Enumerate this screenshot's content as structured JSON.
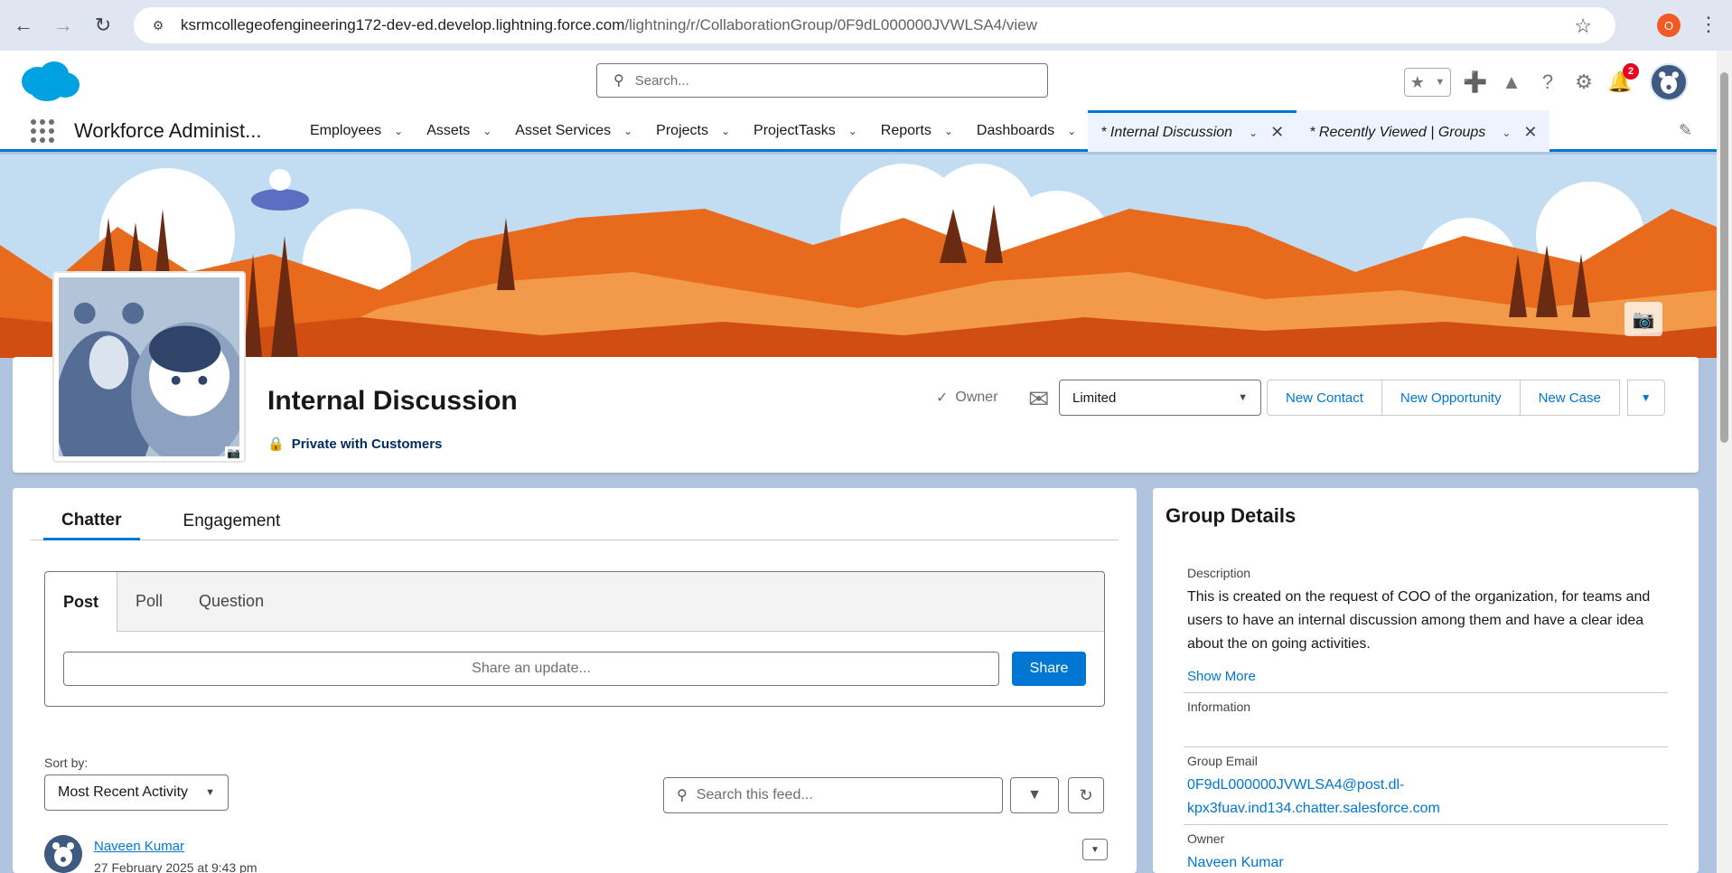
{
  "browser": {
    "url_host": "ksrmcollegeofengineering172-dev-ed.develop.lightning.force.com",
    "url_path": "/lightning/r/CollaborationGroup/0F9dL000000JVWLSA4/view",
    "profile_initial": "O"
  },
  "header": {
    "search_placeholder": "Search...",
    "notification_count": "2"
  },
  "app_nav": {
    "app_name": "Workforce Administ...",
    "items": [
      {
        "label": "Employees"
      },
      {
        "label": "Assets"
      },
      {
        "label": "Asset Services"
      },
      {
        "label": "Projects"
      },
      {
        "label": "ProjectTasks"
      },
      {
        "label": "Reports"
      },
      {
        "label": "Dashboards"
      }
    ],
    "tabs": [
      {
        "label": "* Internal Discussion"
      },
      {
        "label": "* Recently Viewed | Groups"
      }
    ]
  },
  "group": {
    "title": "Internal Discussion",
    "privacy": "Private with Customers",
    "owner_label": "Owner",
    "email_setting": "Limited",
    "actions": [
      "New Contact",
      "New Opportunity",
      "New Case"
    ]
  },
  "chatter": {
    "tabs": [
      "Chatter",
      "Engagement"
    ],
    "publisher_tabs": [
      "Post",
      "Poll",
      "Question"
    ],
    "share_placeholder": "Share an update...",
    "share_button": "Share",
    "sort_label": "Sort by:",
    "sort_value": "Most Recent Activity",
    "feed_search_placeholder": "Search this feed...",
    "post": {
      "author": "Naveen Kumar",
      "date": "27 February 2025 at 9:43 pm"
    }
  },
  "details": {
    "title": "Group Details",
    "description_label": "Description",
    "description": "This is created on the request of COO of the organization, for teams and users to have an internal discussion among them and have a clear idea about the on going activities.",
    "show_more": "Show More",
    "information_label": "Information",
    "group_email_label": "Group Email",
    "group_email_line1": "0F9dL000000JVWLSA4@post.dl-",
    "group_email_line2": "kpx3fuav.ind134.chatter.salesforce.com",
    "owner_label": "Owner",
    "owner_value": "Naveen Kumar"
  }
}
